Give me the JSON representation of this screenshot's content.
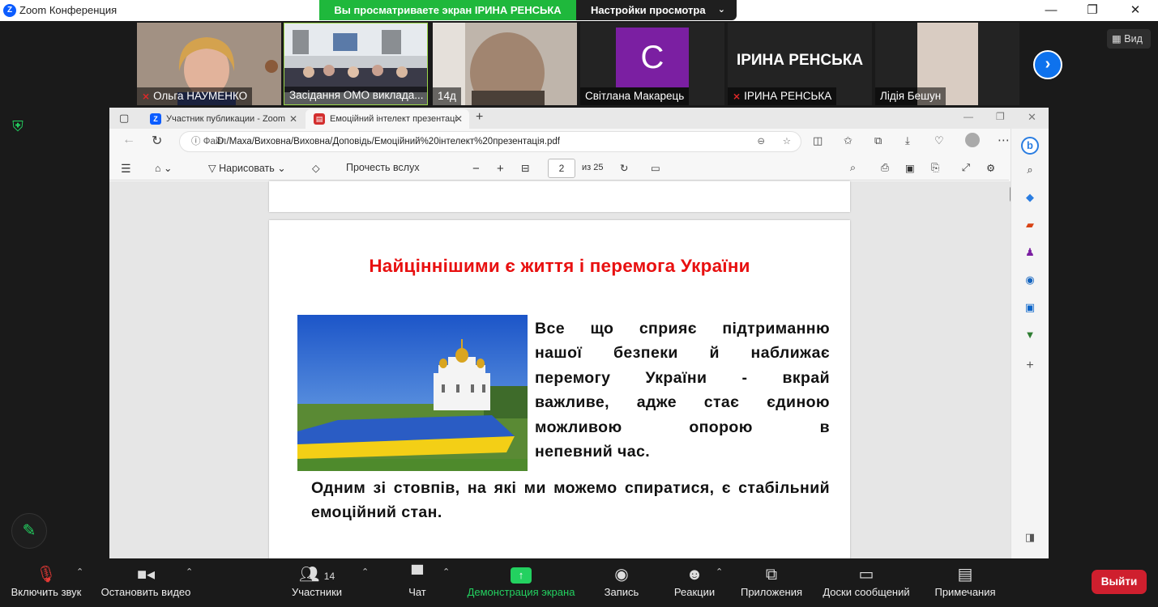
{
  "window": {
    "title": "Zoom Конференция",
    "share_banner": "Вы просматриваете экран ІРИНА РЕНСЬКА",
    "view_settings": "Настройки просмотра",
    "view_button": "Вид"
  },
  "participants": [
    {
      "name": "Ольга НАУМЕНКО",
      "muted": true
    },
    {
      "name": "Засідання ОМО виклада..."
    },
    {
      "name": "14д"
    },
    {
      "name": "Світлана Макарець",
      "avatar_letter": "С",
      "avatar_color": "#7b1fa2"
    },
    {
      "name": "ІРИНА РЕНСЬКА",
      "muted": true,
      "big_name": "ІРИНА РЕНСЬКА"
    },
    {
      "name": "Лідія Бешун"
    }
  ],
  "browser": {
    "tabs": [
      {
        "label": "Участник публикации - Zoom",
        "icon_color": "#0b5cff"
      },
      {
        "label": "Емоційний інтелект презентаці",
        "icon_color": "#d32f2f"
      }
    ],
    "url_prefix": "Файл",
    "url": "D:/Маха/Виховна/Виховна/Доповідь/Емоційний%20інтелект%20презентація.pdf",
    "pdf_toolbar": {
      "draw_label": "Нарисовать",
      "read_aloud": "Прочесть вслух",
      "page_current": "2",
      "page_total": "из 25"
    }
  },
  "slide": {
    "title": "Найціннішими є життя і перемога України",
    "paragraph1_lines": [
      "Все що сприяє підтриманню",
      "нашої безпеки й наближає",
      "перемогу України - вкрай",
      "важливе, адже стає єдиною",
      "можливою опорою в"
    ],
    "paragraph1_last": "непевний час.",
    "paragraph2": "Одним зі стовпів, на які ми можемо спиратися, є стабільний емоційний стан."
  },
  "toolbar": {
    "unmute": "Включить звук",
    "stop_video": "Остановить видео",
    "participants": "Участники",
    "participants_count": "14",
    "chat": "Чат",
    "share_screen": "Демонстрация экрана",
    "record": "Запись",
    "reactions": "Реакции",
    "apps": "Приложения",
    "whiteboards": "Доски сообщений",
    "notes": "Примечания",
    "leave": "Выйти"
  },
  "colors": {
    "share_green": "#1fb83c",
    "slide_title_red": "#e81010",
    "leave_red": "#cf1f2e"
  }
}
